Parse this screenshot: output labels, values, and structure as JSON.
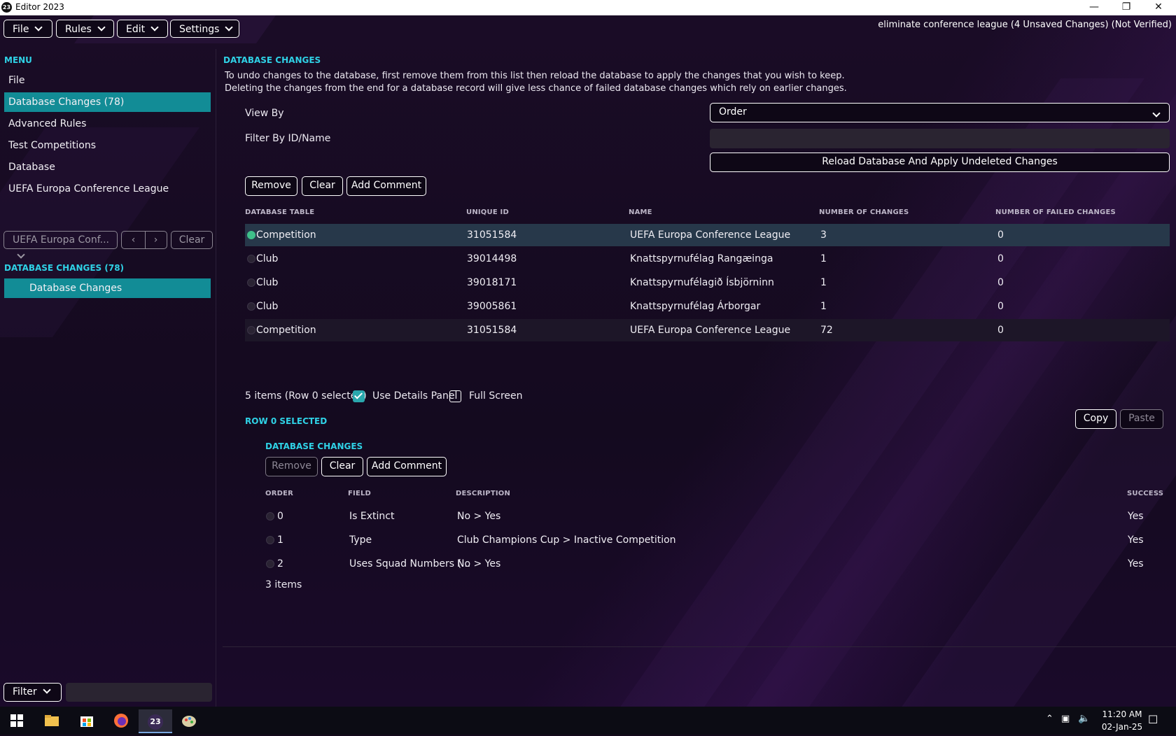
{
  "window": {
    "title": "Editor 2023",
    "app_icon": "23",
    "minimize_icon": "minimize-icon",
    "maximize_icon": "restore-icon",
    "close_icon": "close-icon"
  },
  "menubar": {
    "items": [
      "File",
      "Rules",
      "Edit",
      "Settings"
    ],
    "status": "eliminate conference league (4 Unsaved Changes) (Not Verified)"
  },
  "sidebar": {
    "menu_heading": "MENU",
    "items": [
      "File",
      "Database Changes (78)",
      "Advanced Rules",
      "Test Competitions",
      "Database",
      "UEFA Europa Conference League"
    ],
    "selected_index": 1,
    "nav_select": "UEFA Europa Conf...",
    "nav_clear": "Clear",
    "changes_heading": "DATABASE CHANGES (78)",
    "changes_item": "Database Changes",
    "filter_label": "Filter",
    "filter_value": ""
  },
  "main": {
    "heading": "DATABASE CHANGES",
    "desc_line1": "To undo changes to the database, first remove them from this list then reload the database to apply the changes that you wish to keep.",
    "desc_line2": "Deleting the changes from the end for a database record will give less chance of failed database changes which rely on earlier changes.",
    "view_by_label": "View By",
    "view_by_value": "Order",
    "filter_label": "Filter By ID/Name",
    "filter_value": "",
    "reload_button": "Reload Database And Apply Undeleted Changes",
    "remove_button": "Remove",
    "clear_button": "Clear",
    "add_comment_button": "Add Comment",
    "columns": [
      "DATABASE TABLE",
      "UNIQUE ID",
      "NAME",
      "NUMBER OF CHANGES",
      "NUMBER OF FAILED CHANGES"
    ],
    "rows": [
      {
        "table": "Competition",
        "id": "31051584",
        "name": "UEFA Europa Conference League",
        "changes": "3",
        "failed": "0"
      },
      {
        "table": "Club",
        "id": "39014498",
        "name": "Knattspyrnufélag Rangæinga",
        "changes": "1",
        "failed": "0"
      },
      {
        "table": "Club",
        "id": "39018171",
        "name": "Knattspyrnufélagið Ísbjörninn",
        "changes": "1",
        "failed": "0"
      },
      {
        "table": "Club",
        "id": "39005861",
        "name": "Knattspyrnufélag Árborgar",
        "changes": "1",
        "failed": "0"
      },
      {
        "table": "Competition",
        "id": "31051584",
        "name": "UEFA Europa Conference League",
        "changes": "72",
        "failed": "0"
      }
    ],
    "items_status": "5 items (Row 0 selected)",
    "use_details_panel": "Use Details Panel",
    "use_details_checked": true,
    "full_screen": "Full Screen",
    "full_screen_checked": false,
    "row_selected_heading": "ROW 0 SELECTED",
    "copy_button": "Copy",
    "paste_button": "Paste"
  },
  "details": {
    "heading": "DATABASE CHANGES",
    "remove_button": "Remove",
    "clear_button": "Clear",
    "add_comment_button": "Add Comment",
    "columns": [
      "ORDER",
      "FIELD",
      "DESCRIPTION",
      "SUCCESS"
    ],
    "rows": [
      {
        "order": "0",
        "field": "Is Extinct",
        "description": "No > Yes",
        "success": "Yes"
      },
      {
        "order": "1",
        "field": "Type",
        "description": "Club Champions Cup > Inactive Competition",
        "success": "Yes"
      },
      {
        "order": "2",
        "field": "Uses Squad Numbers (...",
        "description": "No > Yes",
        "success": "Yes"
      }
    ],
    "items_status": "3 items"
  },
  "taskbar": {
    "apps": [
      "start-icon",
      "file-explorer-icon",
      "store-icon",
      "firefox-icon",
      "editor-2023-icon",
      "paint-icon"
    ],
    "time": "11:20 AM",
    "date": "02-Jan-25"
  },
  "colors": {
    "accent": "#2fd2e6",
    "selected": "#128c96",
    "selected_row": "#27384a"
  }
}
